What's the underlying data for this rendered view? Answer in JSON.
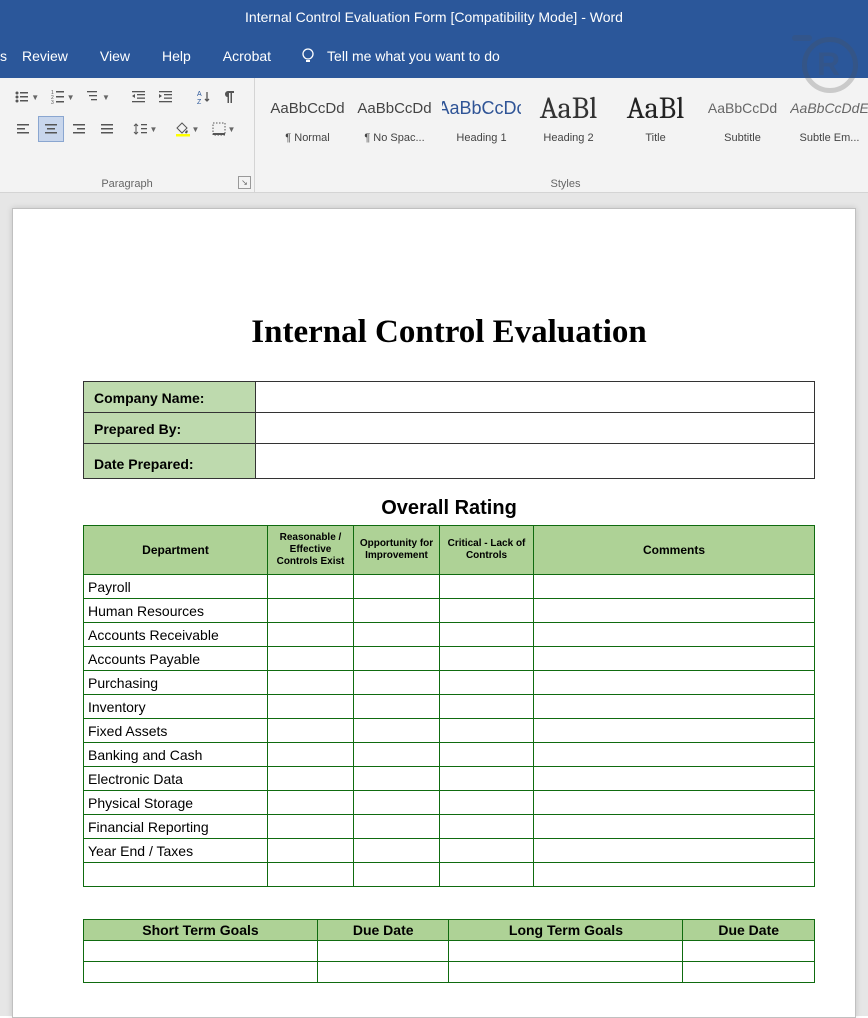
{
  "titlebar": {
    "title": "Internal Control Evaluation Form [Compatibility Mode]  -  Word"
  },
  "menubar": {
    "items": [
      "Review",
      "View",
      "Help",
      "Acrobat"
    ],
    "tellme": "Tell me what you want to do"
  },
  "styles_gallery": [
    {
      "preview": "AaBbCcDd",
      "name": "¶ Normal",
      "class": ""
    },
    {
      "preview": "AaBbCcDd",
      "name": "¶ No Spac...",
      "class": ""
    },
    {
      "preview": "AaBbCcDc",
      "name": "Heading 1",
      "class": "heading1"
    },
    {
      "preview": "AaBl",
      "name": "Heading 2",
      "class": "heading2"
    },
    {
      "preview": "AaBl",
      "name": "Title",
      "class": "title"
    },
    {
      "preview": "AaBbCcDd",
      "name": "Subtitle",
      "class": "subtitle"
    },
    {
      "preview": "AaBbCcDdE",
      "name": "Subtle Em...",
      "class": "emphasis"
    }
  ],
  "ribbon_labels": {
    "paragraph": "Paragraph",
    "styles": "Styles"
  },
  "document": {
    "title": "Internal Control Evaluation",
    "header_rows": [
      {
        "label": "Company Name:",
        "value": ""
      },
      {
        "label": "Prepared By:",
        "value": ""
      },
      {
        "label": "Date Prepared:",
        "value": ""
      }
    ],
    "rating": {
      "title": "Overall Rating",
      "headers": [
        "Department",
        "Reasonable / Effective Controls Exist",
        "Opportunity for Improvement",
        "Critical - Lack of Controls",
        "Comments"
      ],
      "rows": [
        "Payroll",
        "Human Resources",
        "Accounts Receivable",
        "Accounts Payable",
        "Purchasing",
        "Inventory",
        "Fixed Assets",
        "Banking and Cash",
        "Electronic Data",
        "Physical Storage",
        "Financial Reporting",
        "Year End / Taxes"
      ]
    },
    "goals": {
      "headers": [
        "Short Term Goals",
        "Due Date",
        "Long Term Goals",
        "Due Date"
      ]
    }
  }
}
